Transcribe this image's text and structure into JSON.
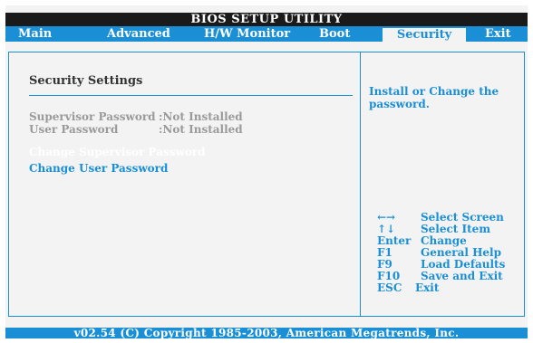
{
  "title": "BIOS SETUP UTILITY",
  "tabs": [
    "Main",
    "Advanced",
    "H/W Monitor",
    "Boot",
    "Security",
    "Exit"
  ],
  "active_tab": "Security",
  "section_title": "Security Settings",
  "rows": [
    {
      "label": "Supervisor Password",
      "value": ":Not Installed"
    },
    {
      "label": "User Password",
      "value": ":Not Installed"
    }
  ],
  "links": [
    "Change Supervisor Password",
    "Change User Password"
  ],
  "selected_link": "Change Supervisor Password",
  "help_text": "Install or Change the password.",
  "keys": [
    {
      "key": "←→",
      "desc": "Select Screen"
    },
    {
      "key": "↑↓",
      "desc": "Select Item"
    },
    {
      "key": "Enter",
      "desc": "Change"
    },
    {
      "key": "F1",
      "desc": "General Help"
    },
    {
      "key": "F9",
      "desc": "Load Defaults"
    },
    {
      "key": "F10",
      "desc": "Save and Exit"
    },
    {
      "key": "ESC",
      "desc": "Exit"
    }
  ],
  "footer": "v02.54 (C) Copyright 1985-2003, American Megatrends, Inc.",
  "colors": {
    "accent": "#1a8fd6",
    "selected_text": "#ffffff",
    "muted_text": "#9a9a9a",
    "panel_bg": "#f3f3f3"
  }
}
